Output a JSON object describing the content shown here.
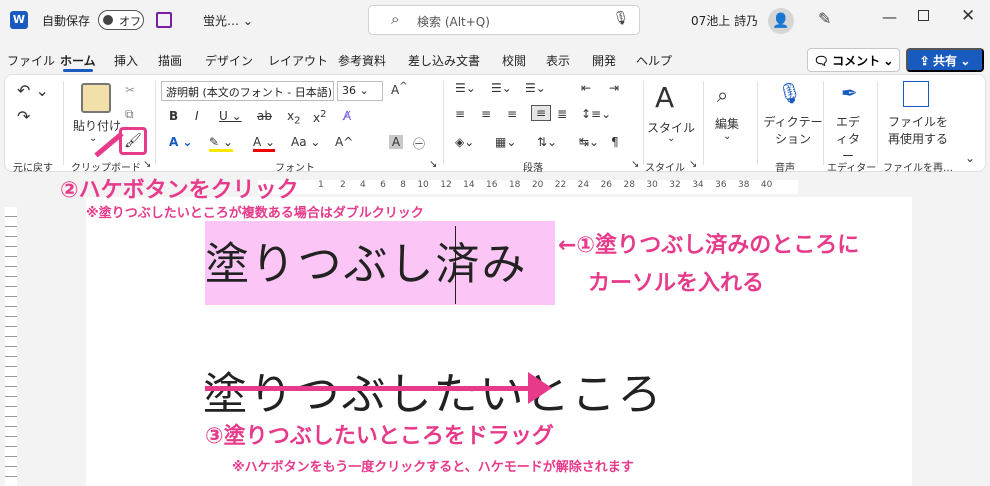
{
  "titlebar": {
    "logo": "W",
    "autosave_label": "自動保存",
    "autosave_state": "オフ",
    "doc_title": "蛍光…",
    "search_placeholder": "検索 (Alt+Q)",
    "user_name": "07池上 詩乃"
  },
  "menu": [
    "ファイル",
    "ホーム",
    "挿入",
    "描画",
    "デザイン",
    "レイアウト",
    "参考資料",
    "差し込み文書",
    "校閲",
    "表示",
    "開発",
    "ヘルプ"
  ],
  "menu_right": {
    "comment": "コメント",
    "share": "共有"
  },
  "ribbon": {
    "undo_group": "元に戻す",
    "paste": "貼り付け",
    "clipboard_group": "クリップボード",
    "font_name": "游明朝 (本文のフォント - 日本語)",
    "font_size": "36",
    "font_group": "フォント",
    "paragraph_group": "段落",
    "style_btn": "スタイル",
    "style_group": "スタイル",
    "edit_btn": "編集",
    "dictation_btn": "ディクテーション",
    "voice_group": "音声",
    "editor_btn": "エディター",
    "editor_group": "エディター",
    "reuse_btn": "ファイルを再使用する",
    "reuse_group": "ファイルを再…"
  },
  "ruler_numbers": [
    "1",
    "2",
    "4",
    "6",
    "8",
    "10",
    "12",
    "14",
    "16",
    "18",
    "20",
    "22",
    "24",
    "26",
    "28",
    "30",
    "32",
    "34",
    "36",
    "38",
    "40"
  ],
  "document": {
    "line1_left": "塗りつぶし",
    "line1_right": "済み",
    "line2_struck": "塗りつぶしたい",
    "line2_rest": "ところ"
  },
  "annotations": {
    "step2": "②ハケボタンをクリック",
    "step2_note": "※塗りつぶしたいところが複数ある場合はダブルクリック",
    "step1_line1": "←①塗りつぶし済みのところに",
    "step1_line2": "カーソルを入れる",
    "step3": "③塗りつぶしたいところをドラッグ",
    "step3_note": "※ハケボタンをもう一度クリックすると、ハケモードが解除されます"
  },
  "colors": {
    "accent": "#185abd",
    "annotation": "#e73a8a",
    "highlight": "#fbc6f5"
  }
}
